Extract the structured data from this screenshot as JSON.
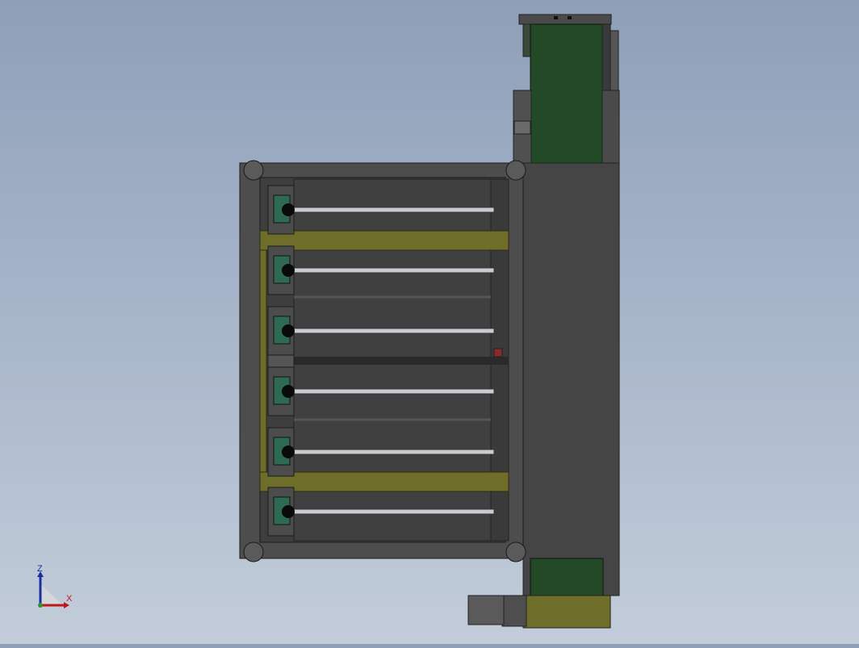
{
  "viewport": {
    "background_top": "#8e9fb8",
    "background_bottom": "#c3cdda",
    "colors": {
      "frame": "#4a4a4a",
      "panel": "#3d3d3d",
      "belt_green": "#234a26",
      "olive_bar": "#6e6e2a",
      "roller_bar": "#c8ccd0",
      "bearing_green": "#2e6a52",
      "motor_gray": "#5a5a5a"
    },
    "roller_count": 6
  },
  "triad": {
    "z_label": "Z",
    "x_label": "X",
    "z_color": "#1c2f9c",
    "x_color": "#c01818",
    "y_color": "#2a9a2a"
  }
}
